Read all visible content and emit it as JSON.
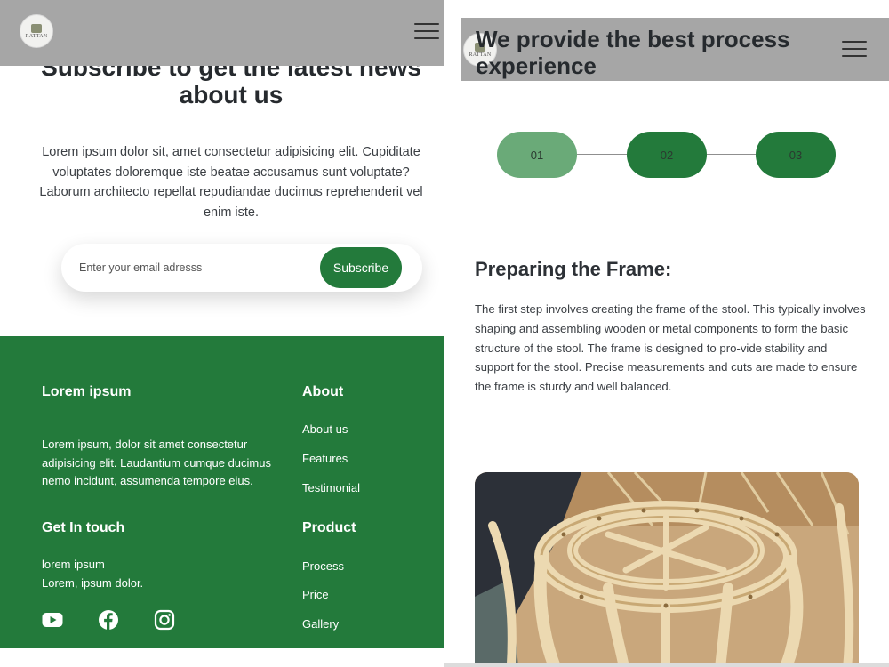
{
  "left_panel": {
    "logo_text": "RATTAN",
    "subscribe": {
      "title": "Subscribe to get the latest news about us",
      "body": "Lorem ipsum dolor sit, amet consectetur adipisicing elit. Cupiditate voluptates doloremque iste beatae accusamus sunt voluptate? Laborum architecto repellat repudiandae ducimus reprehenderit vel enim iste.",
      "email_placeholder": "Enter your email adresss",
      "button_label": "Subscribe"
    },
    "footer": {
      "brand_heading": "Lorem ipsum",
      "brand_text": "Lorem ipsum, dolor sit amet consectetur adipisicing elit. Laudantium cumque ducimus nemo incidunt, assumenda tempore eius.",
      "contact_heading": "Get In touch",
      "contact_line1": "lorem ipsum",
      "contact_line2": "Lorem, ipsum dolor.",
      "about_heading": "About",
      "about_links": [
        "About us",
        "Features",
        "Testimonial"
      ],
      "product_heading": "Product",
      "product_links": [
        "Process",
        "Price",
        "Gallery"
      ],
      "social_icons": [
        "youtube-icon",
        "facebook-icon",
        "instagram-icon"
      ]
    }
  },
  "right_panel": {
    "logo_text": "RATTAN",
    "title": "We provide the best process experience",
    "steps": [
      "01",
      "02",
      "03"
    ],
    "active_step": "01",
    "section_title": "Preparing the Frame:",
    "section_body": "The first step involves creating the frame of the stool. This typically involves shaping and assembling wooden or metal components to form the basic structure of the stool. The frame is designed to pro-vide stability and support for the stool. Precise measurements and cuts are made to ensure the frame is sturdy and well balanced."
  },
  "colors": {
    "brand_green": "#237a3b",
    "step_active": "#6aaa78",
    "step_inactive": "#237a3b",
    "header_gray": "#a6a6a6"
  }
}
